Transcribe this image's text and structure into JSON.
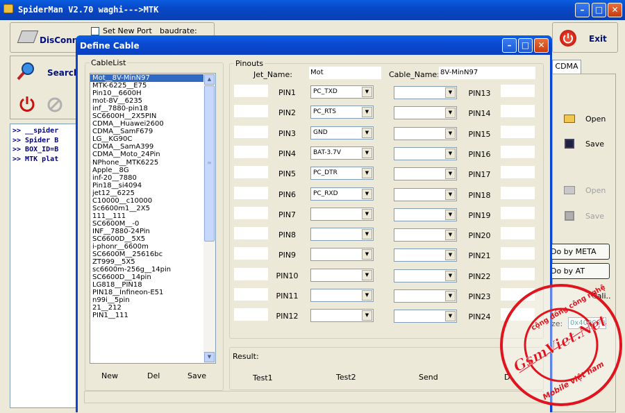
{
  "main_window": {
    "title": "SpiderMan V2.70 waghi--->MTK",
    "disconnect": "DisConnec",
    "set_new_port": "Set New Port",
    "baudrate": "baudrate:",
    "search": "Search",
    "exit": "Exit",
    "console_lines": [
      ">> __spider",
      ">> Spider B",
      ">> BOX_ID=B",
      ">> MTK plat"
    ],
    "tab_cdma": "CDMA",
    "open": "Open",
    "save": "Save",
    "open2": "Open",
    "save2": "Save",
    "do_meta": "Do by META",
    "do_at": "Do by AT",
    "cali": "Cali..",
    "size_label": "ze:",
    "size_value": "0x400000"
  },
  "dialog": {
    "title": "Define Cable",
    "cablelist_label": "CableList",
    "pinouts_label": "Pinouts",
    "jet_name_label": "Jet_Name:",
    "jet_name_value": "Mot",
    "cable_name_label": "Cable_Name:",
    "cable_name_value": "8V-MinN97",
    "result_label": "Result:",
    "test1": "Test1",
    "test2": "Test2",
    "send": "Send",
    "partial_button": "D",
    "new": "New",
    "del": "Del",
    "save": "Save"
  },
  "cables": [
    "Mot__8V-MinN97",
    "MTK-6225__E75",
    "Pin10__6600H",
    "mot-8V__6235",
    "inf__7880-pin18",
    "SC6600H__2X5PIN",
    "CDMA__Huawei2600",
    "CDMA__SamF679",
    "LG__KG90C",
    "CDMA__SamA399",
    "CDMA__Moto_24Pin",
    "NPhone__MTK6225",
    "Apple__8G",
    "inf-20__7880",
    "Pin18__si4094",
    "jet12__6225",
    "C10000__c10000",
    "Sc6600m1__2X5",
    "111__111",
    "SC6600M__-0",
    "INF__7880-24Pin",
    "SC6600D__5X5",
    "i-phonr__6600m",
    "SC6600M__25616bc",
    "ZT999__5X5",
    "sc6600m-256g__14pin",
    "SC6600D__14pin",
    "LG818__PIN18",
    "PIN18__Infineon-E51",
    "n99i__5pin",
    "21__212",
    "PIN1__111"
  ],
  "pins_left": [
    {
      "label": "PIN1",
      "value": "PC_TXD"
    },
    {
      "label": "PIN2",
      "value": "PC_RTS"
    },
    {
      "label": "PIN3",
      "value": "GND"
    },
    {
      "label": "PIN4",
      "value": "BAT-3.7V"
    },
    {
      "label": "PIN5",
      "value": "PC_DTR"
    },
    {
      "label": "PIN6",
      "value": "PC_RXD"
    },
    {
      "label": "PIN7",
      "value": ""
    },
    {
      "label": "PIN8",
      "value": ""
    },
    {
      "label": "PIN9",
      "value": ""
    },
    {
      "label": "PIN10",
      "value": ""
    },
    {
      "label": "PIN11",
      "value": ""
    },
    {
      "label": "PIN12",
      "value": ""
    }
  ],
  "pins_right": [
    {
      "label": "PIN13",
      "value": ""
    },
    {
      "label": "PIN14",
      "value": ""
    },
    {
      "label": "PIN15",
      "value": ""
    },
    {
      "label": "PIN16",
      "value": ""
    },
    {
      "label": "PIN17",
      "value": ""
    },
    {
      "label": "PIN18",
      "value": ""
    },
    {
      "label": "PIN19",
      "value": ""
    },
    {
      "label": "PIN20",
      "value": ""
    },
    {
      "label": "PIN21",
      "value": ""
    },
    {
      "label": "PIN22",
      "value": ""
    },
    {
      "label": "PIN23",
      "value": ""
    },
    {
      "label": "PIN24",
      "value": ""
    }
  ],
  "watermark": {
    "brand": "GsmViet.Net",
    "top": "cộng đồng công nghệ",
    "bottom": "Mobile việt nam"
  },
  "colors": {
    "titlebar": "#0a4fd4",
    "console_bg": "#ffffff",
    "console_text": "#000080",
    "stamp": "#e0141e",
    "dialog_bg": "#ece9d8"
  }
}
